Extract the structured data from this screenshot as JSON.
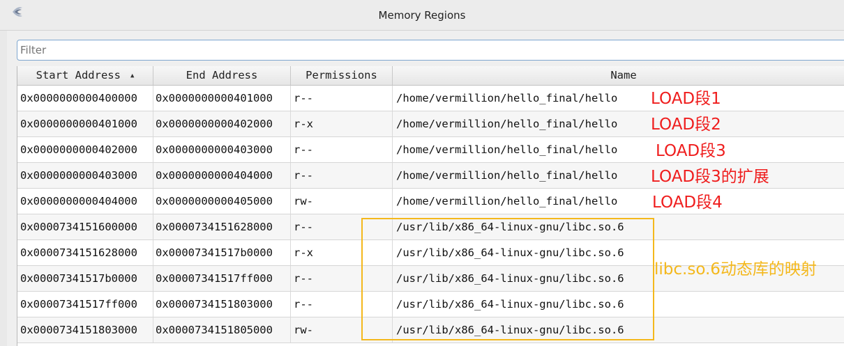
{
  "window": {
    "title": "Memory Regions",
    "app_icon": "edb-logo-icon"
  },
  "filter": {
    "placeholder": "Filter",
    "value": ""
  },
  "table": {
    "columns": [
      "Start Address",
      "End Address",
      "Permissions",
      "Name"
    ],
    "sort_indicator": "▲",
    "rows": [
      {
        "start": "0x0000000000400000",
        "end": "0x0000000000401000",
        "perm": "r--",
        "name": "/home/vermillion/hello_final/hello"
      },
      {
        "start": "0x0000000000401000",
        "end": "0x0000000000402000",
        "perm": "r-x",
        "name": "/home/vermillion/hello_final/hello"
      },
      {
        "start": "0x0000000000402000",
        "end": "0x0000000000403000",
        "perm": "r--",
        "name": "/home/vermillion/hello_final/hello"
      },
      {
        "start": "0x0000000000403000",
        "end": "0x0000000000404000",
        "perm": "r--",
        "name": "/home/vermillion/hello_final/hello"
      },
      {
        "start": "0x0000000000404000",
        "end": "0x0000000000405000",
        "perm": "rw-",
        "name": "/home/vermillion/hello_final/hello"
      },
      {
        "start": "0x0000734151600000",
        "end": "0x0000734151628000",
        "perm": "r--",
        "name": "/usr/lib/x86_64-linux-gnu/libc.so.6"
      },
      {
        "start": "0x0000734151628000",
        "end": "0x00007341517b0000",
        "perm": "r-x",
        "name": "/usr/lib/x86_64-linux-gnu/libc.so.6"
      },
      {
        "start": "0x00007341517b0000",
        "end": "0x00007341517ff000",
        "perm": "r--",
        "name": "/usr/lib/x86_64-linux-gnu/libc.so.6"
      },
      {
        "start": "0x00007341517ff000",
        "end": "0x0000734151803000",
        "perm": "r--",
        "name": "/usr/lib/x86_64-linux-gnu/libc.so.6"
      },
      {
        "start": "0x0000734151803000",
        "end": "0x0000734151805000",
        "perm": "rw-",
        "name": "/usr/lib/x86_64-linux-gnu/libc.so.6"
      }
    ]
  },
  "annotations": {
    "load1": "LOAD段1",
    "load2": "LOAD段2",
    "load3": "LOAD段3",
    "load3_ext": "LOAD段3的扩展",
    "load4": "LOAD段4",
    "libc": "libc.so.6动态库的映射"
  },
  "colors": {
    "annotation_red": "#ef1d1d",
    "annotation_orange": "#f4b81c",
    "filter_border": "#7ea6cf"
  }
}
